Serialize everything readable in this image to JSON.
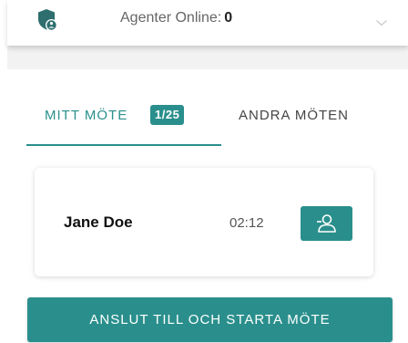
{
  "header": {
    "agents_label": "Agenter Online:",
    "agents_count": "0",
    "icon": "shield-user-icon",
    "dropdown_icon": "chevron-down-icon"
  },
  "tabs": [
    {
      "label": "MITT MÖTE",
      "badge": "1/25",
      "active": true
    },
    {
      "label": "ANDRA MÖTEN",
      "active": false
    }
  ],
  "call_card": {
    "caller_name": "Jane Doe",
    "timer": "02:12",
    "action_icon": "person-icon"
  },
  "join_button": {
    "label": "ANSLUT TILL OCH STARTA MÖTE"
  },
  "colors": {
    "accent": "#2a8f8c",
    "header_icon": "#2e6e6e"
  }
}
